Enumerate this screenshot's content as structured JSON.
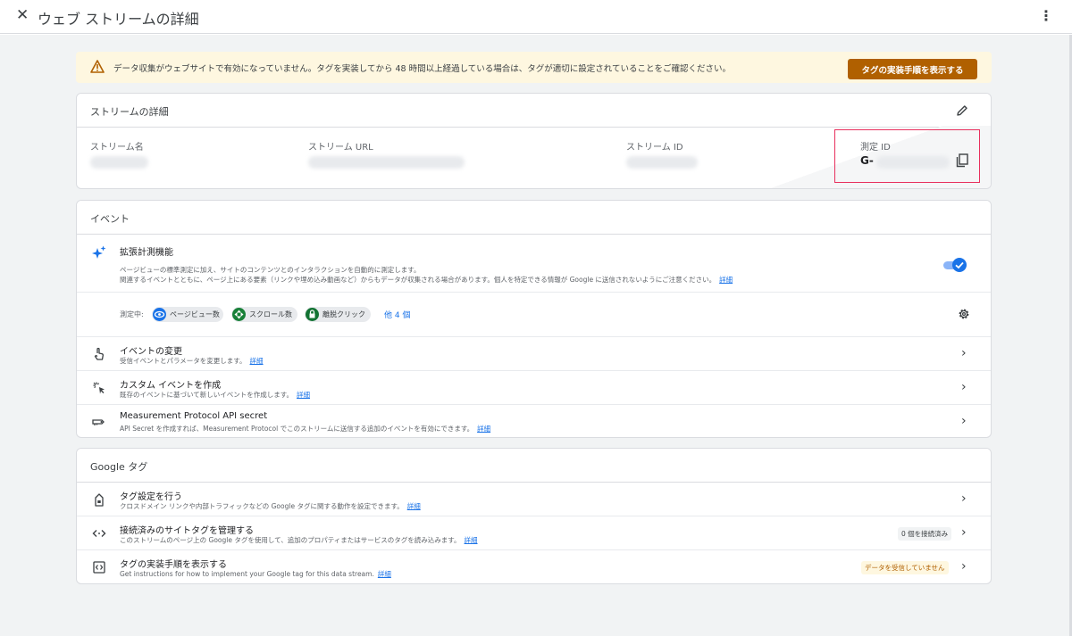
{
  "header": {
    "close_icon": "close-icon",
    "title": "ウェブ ストリームの詳細",
    "menu_icon": "more-vert-icon"
  },
  "alert": {
    "icon": "warning-icon",
    "message": "データ収集がウェブサイトで有効になっていません。タグを実装してから 48 時間以上経過している場合は、タグが適切に設定されていることをご確認ください。",
    "button_label": "タグの実装手順を表示する",
    "button_color": "#b06000"
  },
  "stream_details": {
    "heading": "ストリームの詳細",
    "edit_icon": "pencil-icon",
    "fields": [
      {
        "label": "ストリーム名"
      },
      {
        "label": "ストリーム URL"
      },
      {
        "label": "ストリーム ID"
      },
      {
        "label": "測定 ID",
        "value_prefix": "G-"
      }
    ],
    "copy_icon": "copy-icon",
    "highlight_color": "#e8305d"
  },
  "events": {
    "heading": "イベント",
    "enhanced": {
      "icon": "sparkle-icon",
      "title": "拡張計測機能",
      "desc_line1": "ページビューの標準測定に加え、サイトのコンテンツとのインタラクションを自動的に測定します。",
      "desc_line2": "関連するイベントとともに、ページ上にある要素（リンクや埋め込み動画など）からもデータが収集される場合があります。個人を特定できる情報が Google に送信されないようにご注意ください。",
      "link": "詳細",
      "toggle_on": true,
      "measuring_label": "測定中:",
      "chips": [
        {
          "label": "ページビュー数",
          "icon": "eye-icon",
          "color": "#1a73e8"
        },
        {
          "label": "スクロール数",
          "icon": "scroll-icon",
          "color": "#188038"
        },
        {
          "label": "離脱クリック",
          "icon": "lock-icon",
          "color": "#137333"
        }
      ],
      "more_label": "他 4 個",
      "settings_icon": "gear-icon"
    },
    "rows": [
      {
        "icon": "touch-icon",
        "title": "イベントの変更",
        "desc": "受信イベントとパラメータを変更します。",
        "link": "詳細"
      },
      {
        "icon": "click-sparkle-icon",
        "title": "カスタム イベントを作成",
        "desc": "既存のイベントに基づいて新しいイベントを作成します。",
        "link": "詳細"
      },
      {
        "icon": "key-icon",
        "title": "Measurement Protocol API secret",
        "desc": "API Secret を作成すれば、Measurement Protocol でこのストリームに送信する追加のイベントを有効にできます。",
        "link": "詳細"
      }
    ]
  },
  "google_tag": {
    "heading": "Google タグ",
    "rows": [
      {
        "icon": "tag-icon",
        "title": "タグ設定を行う",
        "desc": "クロスドメイン リンクや内部トラフィックなどの Google タグに関する動作を設定できます。",
        "link": "詳細"
      },
      {
        "icon": "code-icon",
        "title": "接続済みのサイトタグを管理する",
        "desc": "このストリームのページ上の Google タグを使用して、追加のプロパティまたはサービスのタグを読み込みます。",
        "link": "詳細",
        "badge": "0 個を接続済み"
      },
      {
        "icon": "tag-code-icon",
        "title": "タグの実装手順を表示する",
        "desc": "Get instructions for how to implement your Google tag for this data stream.",
        "link": "詳細",
        "badge": "データを受信していません"
      }
    ]
  }
}
